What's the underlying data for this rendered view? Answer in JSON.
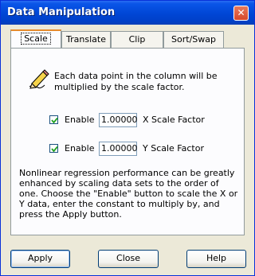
{
  "window": {
    "title": "Data Manipulation",
    "close_glyph": "✕"
  },
  "tabs": [
    {
      "label": "Scale",
      "active": true
    },
    {
      "label": "Translate",
      "active": false
    },
    {
      "label": "Clip",
      "active": false
    },
    {
      "label": "Sort/Swap",
      "active": false
    }
  ],
  "scale": {
    "description": "Each data point in the column will be multiplied by the scale factor.",
    "x_row": {
      "enable_label": "Enable",
      "checked": true,
      "value": "1.00000",
      "factor_label": "X Scale Factor"
    },
    "y_row": {
      "enable_label": "Enable",
      "checked": true,
      "value": "1.00000",
      "factor_label": "Y Scale Factor"
    },
    "note": "Nonlinear regression performance can be greatly enhanced by scaling data sets to the order of one. Choose the \"Enable\" button to scale the X or Y data, enter the constant to multiply by, and press the Apply button."
  },
  "buttons": {
    "apply": "Apply",
    "close": "Close",
    "help": "Help"
  },
  "icons": {
    "pencil": "pencil-icon",
    "close": "close-icon",
    "check": "checkmark-icon"
  }
}
